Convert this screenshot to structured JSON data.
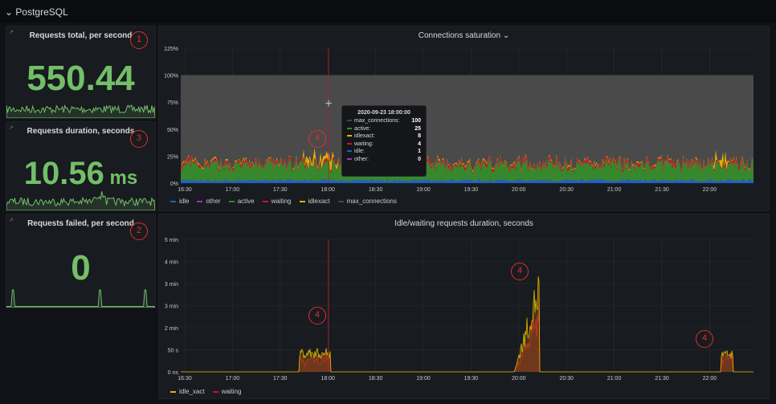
{
  "row_title": "⌄ PostgreSQL",
  "stats": [
    {
      "title": "Requests total, per second",
      "value": "550.44",
      "unit": "",
      "badge": "1"
    },
    {
      "title": "Requests duration, seconds",
      "value": "10.56",
      "unit": " ms",
      "badge": "3"
    },
    {
      "title": "Requests failed, per second",
      "value": "0",
      "unit": "",
      "badge": "2"
    }
  ],
  "colors": {
    "idle": "#1f60c4",
    "other": "#8f3bb8",
    "active": "#37872d",
    "waiting": "#c4162a",
    "idlexact": "#e0b400",
    "max_connections": "#444",
    "stat_green": "#73bf69"
  },
  "x_ticks": [
    "16:30",
    "17:00",
    "17:30",
    "18:00",
    "18:30",
    "19:00",
    "19:30",
    "20:00",
    "20:30",
    "21:00",
    "21:30",
    "22:00"
  ],
  "connections": {
    "title": "Connections saturation ⌄",
    "y_ticks": [
      "0%",
      "25%",
      "50%",
      "75%",
      "100%",
      "125%"
    ],
    "legend": [
      "idle",
      "other",
      "active",
      "waiting",
      "idlexact",
      "max_connections"
    ],
    "tooltip": {
      "time": "2020-09-23 18:00:00",
      "rows": [
        {
          "name": "max_connections:",
          "value": "100",
          "key": "max_connections"
        },
        {
          "name": "active:",
          "value": "25",
          "key": "active"
        },
        {
          "name": "idlexact:",
          "value": "8",
          "key": "idlexact"
        },
        {
          "name": "waiting:",
          "value": "4",
          "key": "waiting"
        },
        {
          "name": "idle:",
          "value": "1",
          "key": "idle"
        },
        {
          "name": "other:",
          "value": "0",
          "key": "other"
        }
      ]
    },
    "badge": "4"
  },
  "idle_waiting": {
    "title": "Idle/waiting requests duration, seconds",
    "y_ticks": [
      "0 ns",
      "50 s",
      "2 min",
      "3 min",
      "3 min",
      "4 min",
      "5 min"
    ],
    "legend": [
      "idle_xact",
      "waiting"
    ],
    "badges": [
      "4",
      "4",
      "4"
    ]
  }
}
